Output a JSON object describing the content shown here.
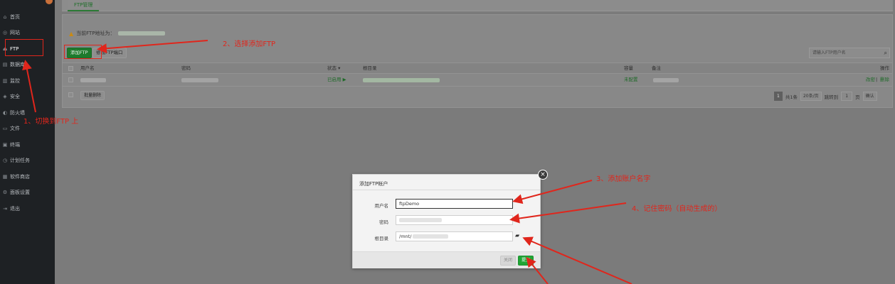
{
  "sidebar": {
    "items": [
      {
        "label": "首页",
        "icon": "home-icon",
        "glyph": "⌂"
      },
      {
        "label": "网站",
        "icon": "globe-icon",
        "glyph": "◎"
      },
      {
        "label": "FTP",
        "icon": "ftp-icon",
        "glyph": "⏏"
      },
      {
        "label": "数据库",
        "icon": "database-icon",
        "glyph": "▤"
      },
      {
        "label": "监控",
        "icon": "monitor-icon",
        "glyph": "▥"
      },
      {
        "label": "安全",
        "icon": "shield-icon",
        "glyph": "◈"
      },
      {
        "label": "防火墙",
        "icon": "firewall-icon",
        "glyph": "◐"
      },
      {
        "label": "文件",
        "icon": "folder-icon",
        "glyph": "▭"
      },
      {
        "label": "终端",
        "icon": "terminal-icon",
        "glyph": "▣"
      },
      {
        "label": "计划任务",
        "icon": "clock-icon",
        "glyph": "◷"
      },
      {
        "label": "软件商店",
        "icon": "store-icon",
        "glyph": "▦"
      },
      {
        "label": "面板设置",
        "icon": "gear-icon",
        "glyph": "⚙"
      },
      {
        "label": "退出",
        "icon": "logout-icon",
        "glyph": "⇥"
      }
    ]
  },
  "tabs": {
    "ftp": "FTP管理"
  },
  "notice": {
    "text": "当前FTP地址为："
  },
  "toolbar": {
    "add_ftp": "添加FTP",
    "modify_port": "修改FTP端口"
  },
  "search": {
    "placeholder": "请输入FTP用户名"
  },
  "table": {
    "headers": {
      "username": "用户名",
      "password": "密码",
      "status": "状态 ▾",
      "root": "根目录",
      "quota": "容量",
      "note": "备注",
      "actions": "操作"
    },
    "row": {
      "status": "已启用 ▶",
      "quota": "未配置",
      "edit": "改密",
      "sep": "|",
      "delete": "删除"
    }
  },
  "footer": {
    "batch_delete": "批量删除",
    "page_current": "1",
    "total": "共1条",
    "per_page": "20条/页",
    "goto_prefix": "跳转到",
    "goto_page": "1",
    "page_suffix": "页",
    "confirm": "确认"
  },
  "modal": {
    "title": "添加FTP帐户",
    "close": "×",
    "fields": {
      "username_label": "用户名",
      "username_value": "ftpDemo",
      "password_label": "密码",
      "root_label": "根目录",
      "root_value": "/mnt/"
    },
    "cancel": "关闭",
    "submit": "提交"
  },
  "annotations": {
    "step1": "1、切换到FTP 上",
    "step2": "2、选择添加FTP",
    "step3": "3、添加账户名字",
    "step4": "4、记住密码（自动生成的）"
  },
  "colors": {
    "accent_green": "#20a535",
    "annotation_red": "#e0261c",
    "sidebar_bg": "#1e2124"
  }
}
